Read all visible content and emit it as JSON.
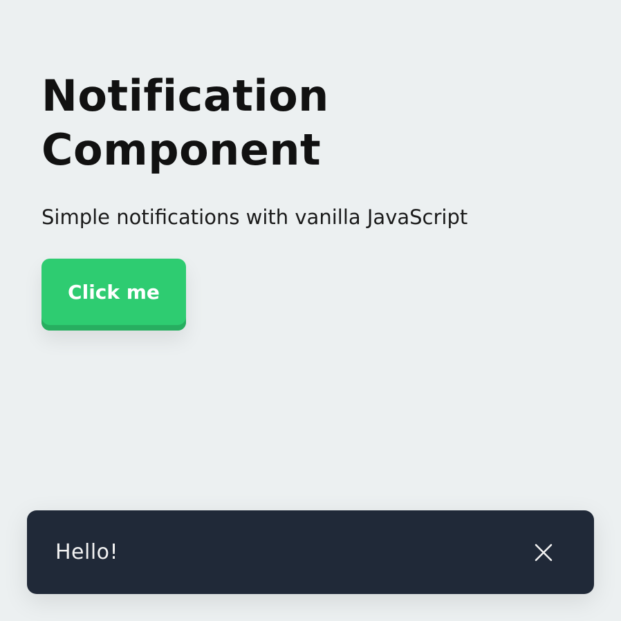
{
  "page": {
    "title": "Notification Component",
    "subtitle": "Simple notifications with vanilla JavaScript"
  },
  "button": {
    "label": "Click me",
    "color": "#2ecc71"
  },
  "notification": {
    "message": "Hello!",
    "close_icon": "close-icon",
    "background": "#202938"
  }
}
